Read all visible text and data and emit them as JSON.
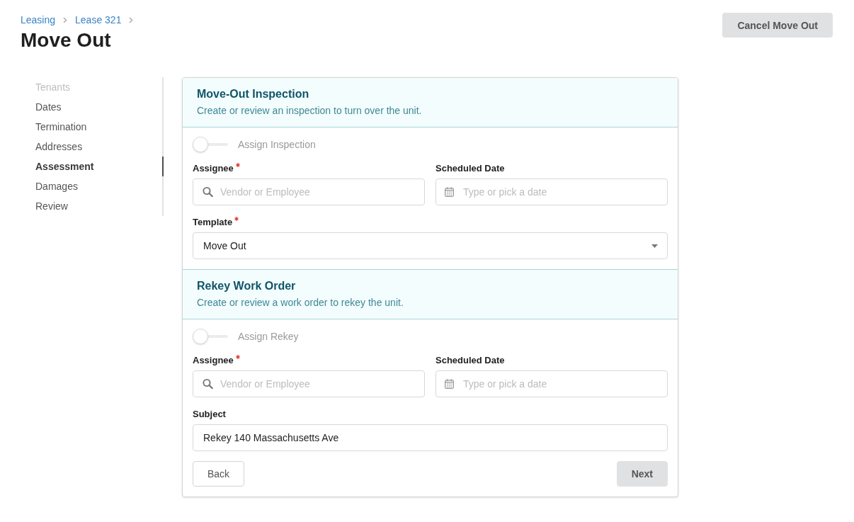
{
  "breadcrumb": [
    {
      "label": "Leasing"
    },
    {
      "label": "Lease 321"
    }
  ],
  "page_title": "Move Out",
  "header_button": "Cancel Move Out",
  "sidebar": {
    "items": [
      {
        "label": "Tenants",
        "selected": false,
        "disabled": true
      },
      {
        "label": "Dates",
        "selected": false,
        "disabled": false
      },
      {
        "label": "Termination",
        "selected": false,
        "disabled": false
      },
      {
        "label": "Addresses",
        "selected": false,
        "disabled": false
      },
      {
        "label": "Assessment",
        "selected": true,
        "disabled": false
      },
      {
        "label": "Damages",
        "selected": false,
        "disabled": false
      },
      {
        "label": "Review",
        "selected": false,
        "disabled": false
      }
    ]
  },
  "sections": [
    {
      "title": "Move-Out Inspection",
      "subtitle": "Create or review an inspection to turn over the unit.",
      "toggle": {
        "label": "Assign Inspection",
        "on": false
      },
      "fields": [
        {
          "kind": "search",
          "label": "Assignee",
          "required": true,
          "placeholder": "Vendor or Employee"
        },
        {
          "kind": "date",
          "label": "Scheduled Date",
          "required": false,
          "placeholder": "Type or pick a date"
        },
        {
          "kind": "select",
          "label": "Template",
          "required": true,
          "value": "Move Out"
        }
      ]
    },
    {
      "title": "Rekey Work Order",
      "subtitle": "Create or review a work order to rekey the unit.",
      "toggle": {
        "label": "Assign Rekey",
        "on": false
      },
      "fields": [
        {
          "kind": "search",
          "label": "Assignee",
          "required": true,
          "placeholder": "Vendor or Employee"
        },
        {
          "kind": "date",
          "label": "Scheduled Date",
          "required": false,
          "placeholder": "Type or pick a date"
        },
        {
          "kind": "text",
          "label": "Subject",
          "required": false,
          "value": "Rekey 140 Massachusetts Ave"
        }
      ]
    }
  ],
  "actions": [
    {
      "label": "Back",
      "kind": "secondary"
    },
    {
      "label": "Next",
      "kind": "primary"
    }
  ]
}
